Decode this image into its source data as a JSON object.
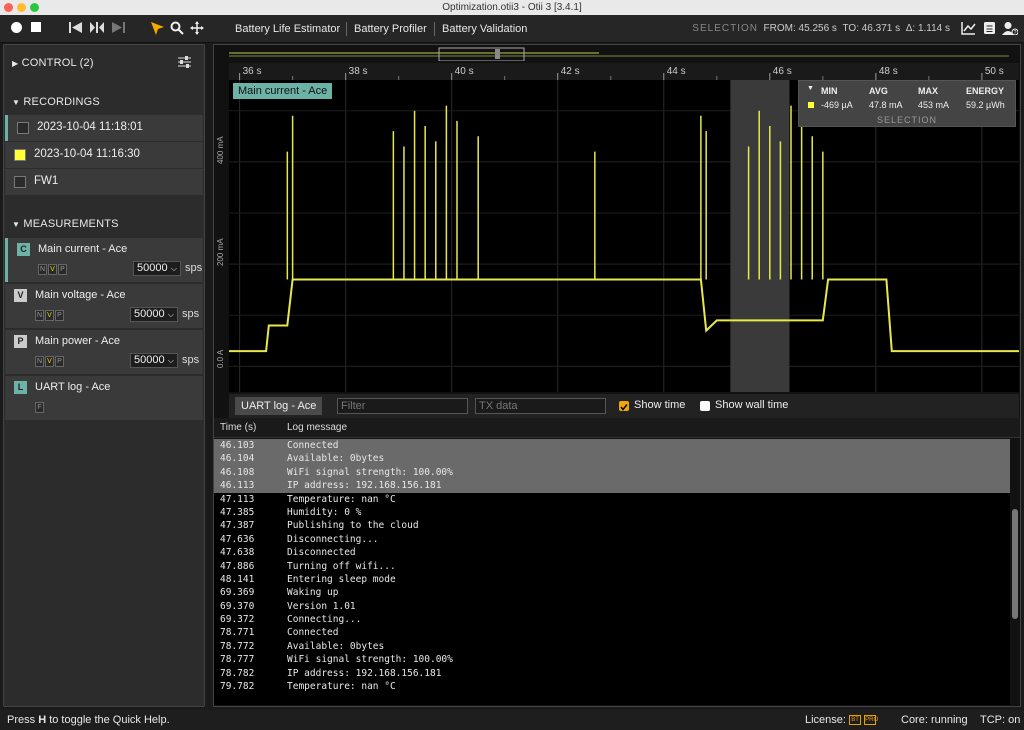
{
  "window": {
    "title": "Optimization.otii3 - Otii 3 [3.4.1]"
  },
  "toolbar": {
    "menus": [
      "Battery Life Estimator",
      "Battery Profiler",
      "Battery Validation"
    ],
    "selection_label": "SELECTION",
    "from_label": "FROM:",
    "from_value": "45.256 s",
    "to_label": "TO:",
    "to_value": "46.371 s",
    "delta_label": "Δ:",
    "delta_value": "1.114 s"
  },
  "sidebar": {
    "control": "CONTROL (2)",
    "recordings_title": "RECORDINGS",
    "recordings": [
      {
        "label": "2023-10-04 11:18:01",
        "color": "#2a2a2a"
      },
      {
        "label": "2023-10-04 11:16:30",
        "color": "#ffff33"
      },
      {
        "label": "FW1",
        "color": "#2a2a2a"
      }
    ],
    "measurements_title": "MEASUREMENTS",
    "measurements": [
      {
        "badge": "C",
        "label": "Main current - Ace",
        "chips": [
          "N",
          "V",
          "P"
        ],
        "sps": "50000",
        "unit": "sps"
      },
      {
        "badge": "V",
        "label": "Main voltage - Ace",
        "chips": [
          "N",
          "V",
          "P"
        ],
        "sps": "50000",
        "unit": "sps"
      },
      {
        "badge": "P",
        "label": "Main power - Ace",
        "chips": [
          "N",
          "V",
          "P"
        ],
        "sps": "50000",
        "unit": "sps"
      },
      {
        "badge": "L",
        "label": "UART log - Ace",
        "chips": [
          "F"
        ]
      }
    ]
  },
  "chart_data": {
    "type": "line",
    "title": "Main current - Ace",
    "xlabel": "",
    "ylabel": "",
    "x_ticks": [
      "36 s",
      "38 s",
      "40 s",
      "42 s",
      "44 s",
      "46 s",
      "48 s",
      "50 s"
    ],
    "y_ticks": [
      "0.0 A",
      "200 mA",
      "400 mA"
    ],
    "xlim": [
      35.8,
      50.7
    ],
    "ylim": [
      -0.05,
      0.56
    ],
    "selection": [
      45.256,
      46.371
    ],
    "series": [
      {
        "color": "#e8e84a",
        "baseline": [
          [
            35.8,
            0.03
          ],
          [
            36.5,
            0.03
          ],
          [
            36.55,
            0.08
          ],
          [
            36.9,
            0.08
          ],
          [
            37.0,
            0.17
          ],
          [
            38.0,
            0.17
          ],
          [
            41.0,
            0.17
          ],
          [
            44.7,
            0.17
          ],
          [
            44.8,
            0.07
          ],
          [
            45.0,
            0.09
          ],
          [
            47.0,
            0.09
          ],
          [
            47.1,
            0.17
          ],
          [
            48.2,
            0.17
          ],
          [
            48.3,
            0.03
          ],
          [
            50.7,
            0.03
          ]
        ],
        "spikes": [
          36.9,
          37.0,
          38.9,
          39.1,
          39.3,
          39.5,
          39.7,
          39.9,
          40.1,
          40.5,
          42.7,
          44.7,
          44.8,
          45.6,
          45.8,
          46.0,
          46.2,
          46.4,
          46.6,
          46.8,
          47.0
        ]
      }
    ]
  },
  "stats": {
    "headers": [
      "MIN",
      "AVG",
      "MAX",
      "ENERGY"
    ],
    "values": [
      "-469 µA",
      "47.8 mA",
      "453 mA",
      "59.2 µWh"
    ],
    "footer": "SELECTION"
  },
  "uart": {
    "tab": "UART log - Ace",
    "filter_placeholder": "Filter",
    "tx_placeholder": "TX data",
    "show_time": "Show time",
    "show_wall_time": "Show wall time",
    "col_time": "Time (s)",
    "col_message": "Log message",
    "rows": [
      {
        "t": "46.103",
        "m": "Connected",
        "hl": true
      },
      {
        "t": "46.104",
        "m": "Available: 0bytes",
        "hl": true
      },
      {
        "t": "46.108",
        "m": "WiFi signal strength: 100.00%",
        "hl": true
      },
      {
        "t": "46.113",
        "m": "IP address: 192.168.156.181",
        "hl": true
      },
      {
        "t": "47.113",
        "m": "Temperature: nan °C",
        "hl": false
      },
      {
        "t": "47.385",
        "m": "Humidity: 0 %",
        "hl": false
      },
      {
        "t": "47.387",
        "m": "Publishing to the cloud",
        "hl": false
      },
      {
        "t": "47.636",
        "m": "Disconnecting...",
        "hl": false
      },
      {
        "t": "47.638",
        "m": "Disconnected",
        "hl": false
      },
      {
        "t": "47.886",
        "m": "Turning off wifi...",
        "hl": false
      },
      {
        "t": "48.141",
        "m": "Entering sleep mode",
        "hl": false
      },
      {
        "t": "69.369",
        "m": "Waking up",
        "hl": false
      },
      {
        "t": "69.370",
        "m": "Version 1.01",
        "hl": false
      },
      {
        "t": "69.372",
        "m": "Connecting...",
        "hl": false
      },
      {
        "t": "78.771",
        "m": "Connected",
        "hl": false
      },
      {
        "t": "78.772",
        "m": "Available: 0bytes",
        "hl": false
      },
      {
        "t": "78.777",
        "m": "WiFi signal strength: 100.00%",
        "hl": false
      },
      {
        "t": "78.782",
        "m": "IP address: 192.168.156.181",
        "hl": false
      },
      {
        "t": "79.782",
        "m": "Temperature: nan °C",
        "hl": false
      }
    ]
  },
  "status": {
    "help_pre": "Press ",
    "help_key": "H",
    "help_post": " to toggle the Quick Help.",
    "license_label": "License:",
    "lic_badges": [
      "BT",
      "PRO"
    ],
    "core": "Core: running",
    "tcp": "TCP: on"
  }
}
